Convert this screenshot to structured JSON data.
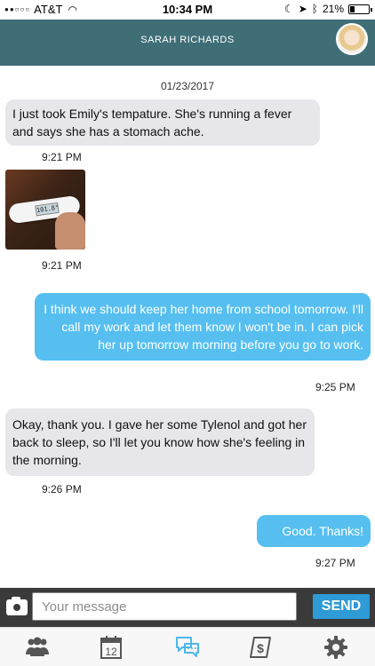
{
  "status_bar": {
    "carrier": "AT&T",
    "time": "10:34 PM",
    "battery": "21%",
    "battery_level": 0.21
  },
  "header": {
    "title": "SARAH RICHARDS"
  },
  "conversation": {
    "date": "01/23/2017",
    "messages": [
      {
        "direction": "in",
        "type": "text",
        "text": "I just took Emily's tempature. She's running a fever and says she has a stomach ache.",
        "time": "9:21 PM"
      },
      {
        "direction": "in",
        "type": "photo",
        "photo_reading": "101.8°",
        "time": "9:21 PM"
      },
      {
        "direction": "out",
        "type": "text",
        "text": "I think we should keep her home from school tomorrow. I'll call my work and let them know I won't be in. I can pick her up tomorrow morning before you go to work.",
        "time": "9:25 PM"
      },
      {
        "direction": "in",
        "type": "text",
        "text": "Okay, thank you. I gave her some Tylenol and got her back to sleep, so I'll let you know how she's feeling in the morning.",
        "time": "9:26 PM"
      },
      {
        "direction": "out",
        "type": "text",
        "text": "Good. Thanks!",
        "time": "9:27 PM"
      }
    ]
  },
  "composer": {
    "placeholder": "Your message",
    "send_label": "SEND",
    "camera_icon": "camera-icon"
  },
  "tab_bar": {
    "items": [
      {
        "icon": "people-icon",
        "active": false
      },
      {
        "icon": "calendar-icon",
        "calendar_day": "12",
        "active": false
      },
      {
        "icon": "chat-bubbles-icon",
        "active": true
      },
      {
        "icon": "expense-icon",
        "active": false
      },
      {
        "icon": "gear-icon",
        "active": false
      }
    ]
  },
  "colors": {
    "header_bg": "#3f6e77",
    "outgoing_bubble": "#56bff0",
    "incoming_bubble": "#e6e6eb",
    "send_button": "#2e9ad6",
    "active_tab": "#4fb7e8",
    "inactive_tab": "#555555"
  }
}
